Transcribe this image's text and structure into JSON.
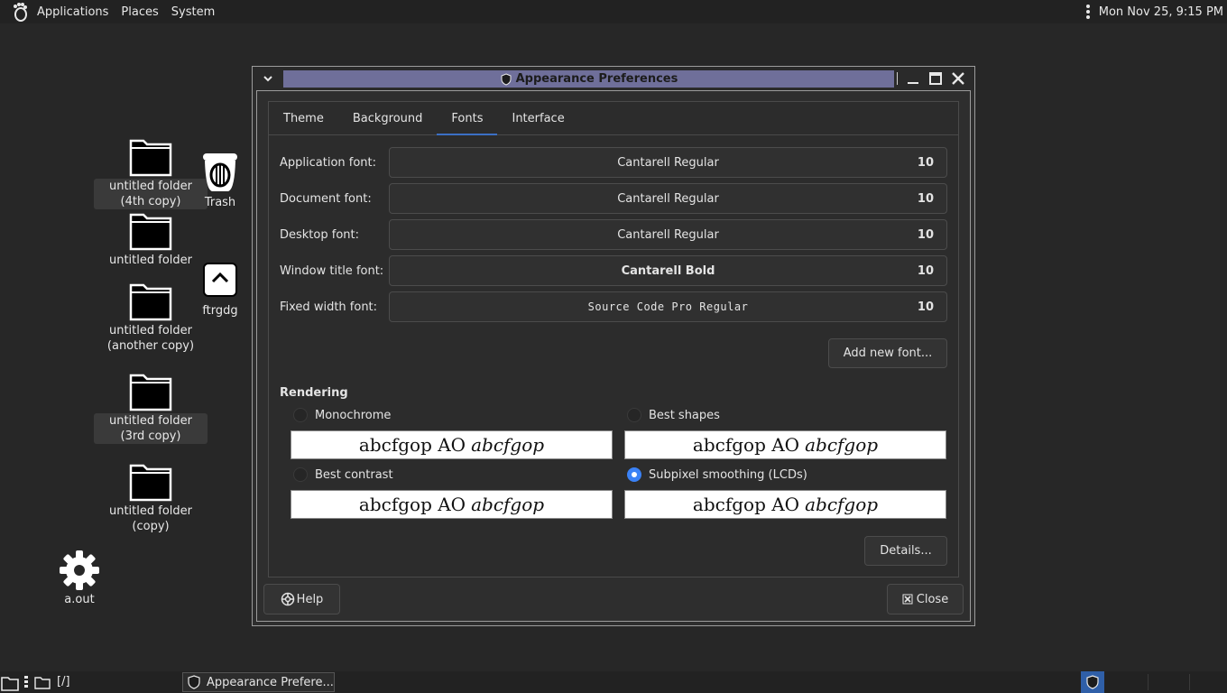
{
  "top_panel": {
    "menus": [
      "Applications",
      "Places",
      "System"
    ],
    "clock": "Mon Nov 25,  9:15 PM"
  },
  "desktop": {
    "icons": [
      {
        "label": "untitled folder (4th copy)",
        "type": "folder"
      },
      {
        "label": "Trash",
        "type": "trash"
      },
      {
        "label": "untitled folder",
        "type": "folder"
      },
      {
        "label": "ftrgdg",
        "type": "file"
      },
      {
        "label": "untitled folder (another copy)",
        "type": "folder"
      },
      {
        "label": "untitled folder (3rd copy)",
        "type": "folder"
      },
      {
        "label": "untitled folder (copy)",
        "type": "folder"
      },
      {
        "label": "a.out",
        "type": "executable"
      }
    ]
  },
  "window": {
    "title": "Appearance Preferences",
    "tabs": [
      "Theme",
      "Background",
      "Fonts",
      "Interface"
    ],
    "active_tab": "Fonts",
    "fonts": [
      {
        "label": "Application font:",
        "name": "Cantarell Regular",
        "size": "10"
      },
      {
        "label": "Document font:",
        "name": "Cantarell Regular",
        "size": "10"
      },
      {
        "label": "Desktop font:",
        "name": "Cantarell Regular",
        "size": "10"
      },
      {
        "label": "Window title font:",
        "name": "Cantarell Bold",
        "size": "10"
      },
      {
        "label": "Fixed width font:",
        "name": "Source Code Pro Regular",
        "size": "10"
      }
    ],
    "add_font_label": "Add new font...",
    "rendering": {
      "title": "Rendering",
      "options": [
        {
          "label": "Monochrome",
          "selected": false
        },
        {
          "label": "Best shapes",
          "selected": false
        },
        {
          "label": "Best contrast",
          "selected": false
        },
        {
          "label": "Subpixel smoothing (LCDs)",
          "selected": true
        }
      ],
      "preview_plain": "abcfgop AO",
      "preview_italic": "abcfgop"
    },
    "details_label": "Details...",
    "help_label": "Help",
    "close_label": "Close"
  },
  "bottom_panel": {
    "path": "[/]",
    "task_label": "Appearance Prefere..."
  },
  "colors": {
    "title_active": "#6f6f9a",
    "accent": "#3b82f6",
    "tab_underline": "#3b6fc4"
  }
}
